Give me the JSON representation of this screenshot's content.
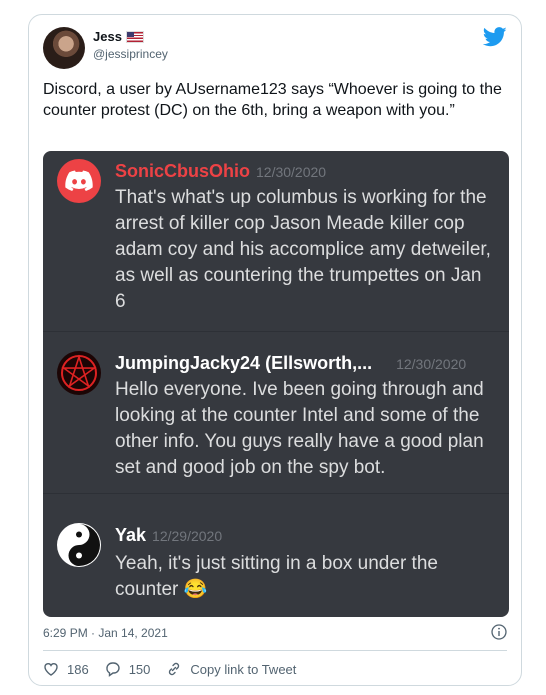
{
  "tweet": {
    "author_name": "Jess",
    "author_handle": "@jessiprincey",
    "text": "Discord, a user by AUsername123 says “Whoever is going to the counter protest (DC) on the 6th, bring a weapon with you.”",
    "timestamp": "6:29 PM · Jan 14, 2021",
    "likes": "186",
    "replies": "150",
    "copy_link_label": "Copy link to Tweet"
  },
  "discord": {
    "messages": [
      {
        "username": "SonicCbusOhio",
        "date": "12/30/2020",
        "username_color": "#ed4245",
        "text": "That's what's up columbus is working for the arrest of killer cop Jason Meade killer cop adam coy and his accomplice amy detweiler, as well as countering the trumpettes on Jan 6",
        "avatar_icon": "discord-logo-icon"
      },
      {
        "username": "JumpingJacky24 (Ellsworth,...",
        "date": "12/30/2020",
        "username_color": "#ffffff",
        "text": "Hello everyone. Ive been going through and looking at the counter Intel and some of the other info. You guys really have a good plan set and good job on the spy bot.",
        "avatar_icon": "pentagram-icon"
      },
      {
        "username": "Yak",
        "date": "12/29/2020",
        "username_color": "#ffffff",
        "text": "Yeah, it's just sitting in a box under the counter 😂",
        "avatar_icon": "yin-yang-icon"
      }
    ]
  },
  "colors": {
    "twitter_blue": "#1d9bf0",
    "discord_bg": "#36393f",
    "discord_text": "#dcddde"
  }
}
